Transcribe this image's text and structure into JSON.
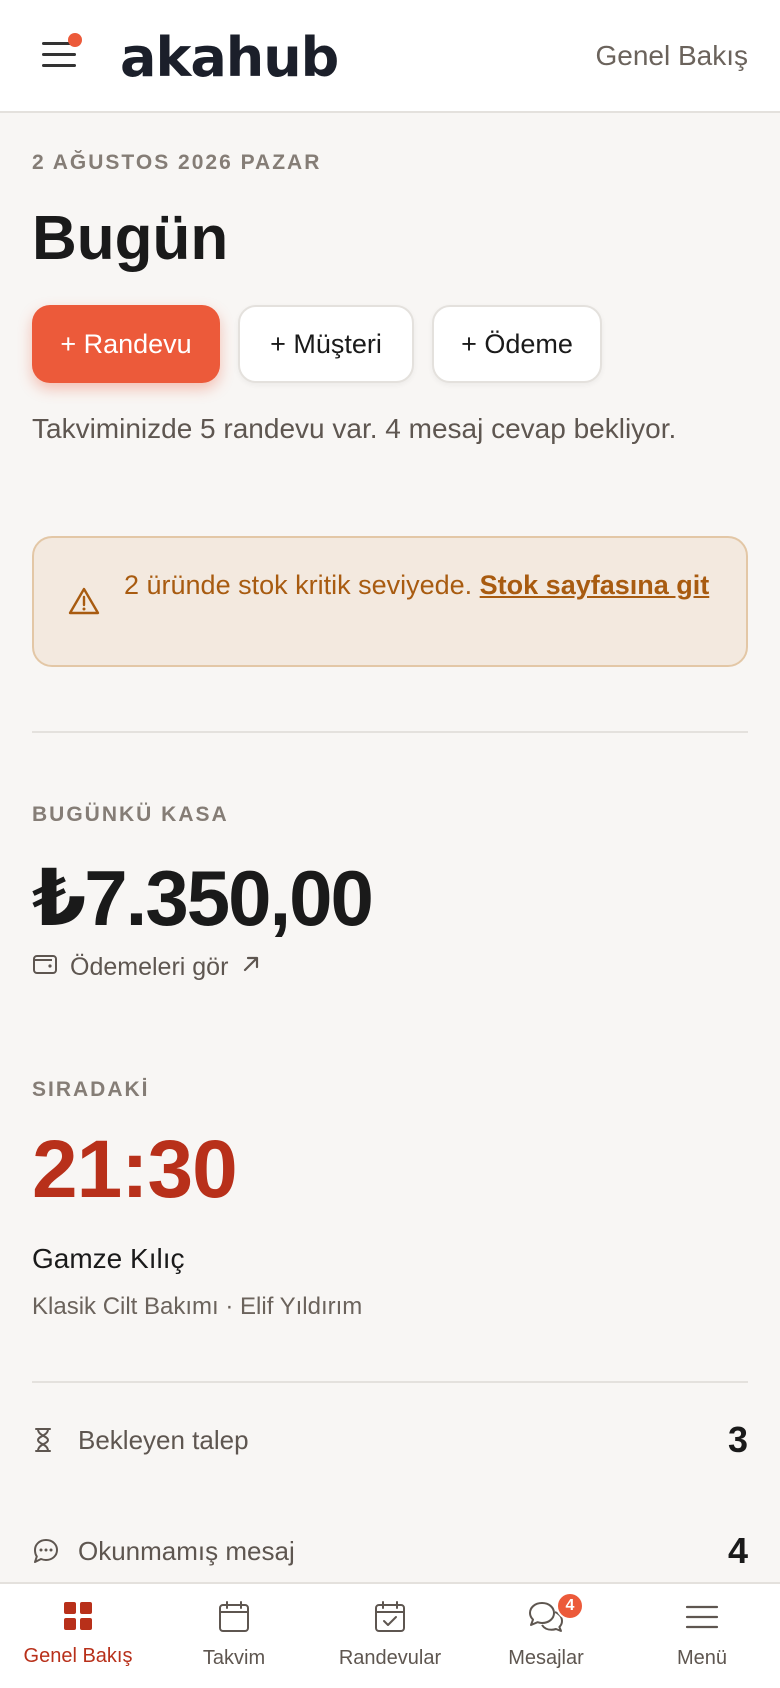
{
  "header": {
    "logo": "akahub",
    "title": "Genel Bakış"
  },
  "main": {
    "date": "2 AĞUSTOS 2026 PAZAR",
    "title": "Bugün",
    "actions": {
      "appointment": "+ Randevu",
      "customer": "+ Müşteri",
      "payment": "+ Ödeme"
    },
    "summary": "Takviminizde 5 randevu var. 4 mesaj cevap bekliyor.",
    "alert": {
      "text": "2 üründe stok kritik seviyede. ",
      "link": "Stok sayfasına git"
    },
    "cash": {
      "label": "BUGÜNKÜ KASA",
      "amount": "₺7.350,00",
      "link": "Ödemeleri gör"
    },
    "next": {
      "label": "SIRADAKİ",
      "time": "21:30",
      "name": "Gamze Kılıç",
      "detail": "Klasik Cilt Bakımı · Elif Yıldırım"
    },
    "stats": [
      {
        "label": "Bekleyen talep",
        "value": "3",
        "icon": "hourglass-icon"
      },
      {
        "label": "Okunmamış mesaj",
        "value": "4",
        "icon": "chat-bubble-icon"
      }
    ]
  },
  "nav": {
    "items": [
      {
        "label": "Genel Bakış",
        "icon": "grid-icon",
        "active": true
      },
      {
        "label": "Takvim",
        "icon": "calendar-icon"
      },
      {
        "label": "Randevular",
        "icon": "calendar-check-icon"
      },
      {
        "label": "Mesajlar",
        "icon": "chat-icon",
        "badge": "4"
      },
      {
        "label": "Menü",
        "icon": "menu-icon"
      }
    ]
  },
  "colors": {
    "accent": "#ec5a3a",
    "accent_dark": "#b8301a",
    "warning_text": "#a85b10",
    "warning_bg": "#f3e9df"
  }
}
